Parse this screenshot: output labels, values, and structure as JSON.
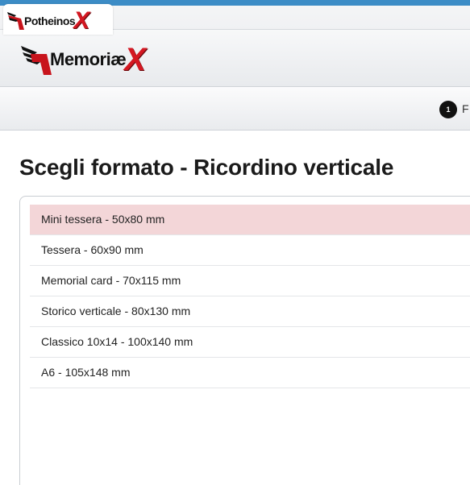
{
  "brand": {
    "small_logo": {
      "word": "Potheinos",
      "mark": "X"
    },
    "main_logo": {
      "word": "Memoriæ",
      "mark": "X"
    }
  },
  "steps": [
    {
      "number": "1",
      "label": "F"
    }
  ],
  "page_title": "Scegli formato - Ricordino verticale",
  "formats": [
    {
      "label": "Mini tessera - 50x80 mm",
      "selected": true
    },
    {
      "label": "Tessera - 60x90 mm",
      "selected": false
    },
    {
      "label": "Memorial card - 70x115 mm",
      "selected": false
    },
    {
      "label": "Storico verticale - 80x130 mm",
      "selected": false
    },
    {
      "label": "Classico 10x14 - 100x140 mm",
      "selected": false
    },
    {
      "label": "A6 - 105x148 mm",
      "selected": false
    }
  ],
  "colors": {
    "accent_red": "#d41822",
    "selected_row": "#f3d6d8",
    "top_stripe": "#3c8cc6"
  }
}
